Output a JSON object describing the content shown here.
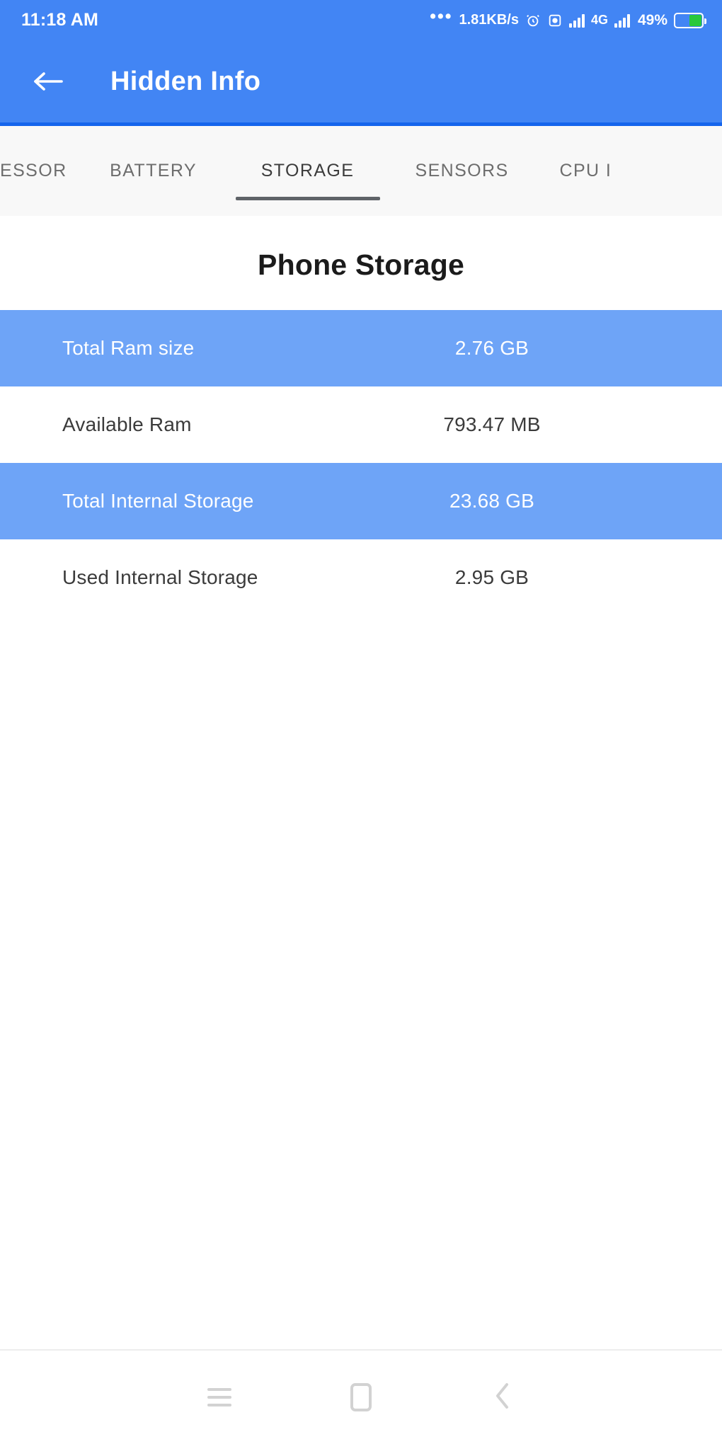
{
  "status_bar": {
    "clock": "11:18 AM",
    "overflow_dots": "•••",
    "network_speed": "1.81KB/s",
    "network_type": "4G",
    "battery_percent": "49%",
    "icons": [
      "alarm-icon",
      "screen-record-icon",
      "signal-bars-icon",
      "sim2-signal-icon",
      "battery-icon"
    ],
    "accent_color": "#4285f4",
    "battery_fill_color": "#28c83c"
  },
  "app_bar": {
    "title": "Hidden Info",
    "back_icon": "arrow-left-icon",
    "background_color": "#4285f4",
    "divider_color": "#1565ec"
  },
  "tabs": {
    "items": [
      {
        "label": "ESSOR",
        "active": false,
        "partial": true
      },
      {
        "label": "BATTERY",
        "active": false,
        "partial": false
      },
      {
        "label": "STORAGE",
        "active": true,
        "partial": false
      },
      {
        "label": "SENSORS",
        "active": false,
        "partial": false
      },
      {
        "label": "CPU I",
        "active": false,
        "partial": true
      }
    ],
    "active_index": 2,
    "indicator_color": "#5f6368"
  },
  "main": {
    "section_title": "Phone Storage",
    "table": {
      "rows": [
        {
          "label": "Total Ram size",
          "value": "2.76 GB",
          "highlighted": true
        },
        {
          "label": "Available Ram",
          "value": "793.47 MB",
          "highlighted": false
        },
        {
          "label": "Total Internal Storage",
          "value": "23.68 GB",
          "highlighted": true
        },
        {
          "label": "Used Internal Storage",
          "value": "2.95 GB",
          "highlighted": false
        }
      ]
    },
    "highlight_color": "#6ea4f7"
  },
  "nav_bar": {
    "buttons": [
      {
        "name": "recents-icon"
      },
      {
        "name": "home-icon"
      },
      {
        "name": "back-icon"
      }
    ]
  }
}
